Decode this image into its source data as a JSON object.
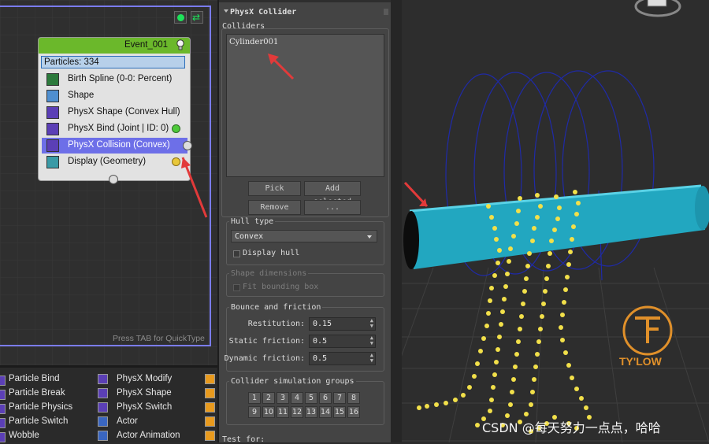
{
  "graph": {
    "quicktype_hint": "Press TAB for QuickType",
    "event": {
      "title": "Event_001",
      "particles": "Particles: 334",
      "operators": [
        {
          "label": "Birth Spline (0-0: Percent)",
          "icon": "birth-spline-icon",
          "selected": false
        },
        {
          "label": "Shape",
          "icon": "shape-icon",
          "selected": false
        },
        {
          "label": "PhysX Shape (Convex Hull)",
          "icon": "physx-shape-icon",
          "selected": false
        },
        {
          "label": "PhysX Bind (Joint | ID: 0)",
          "icon": "physx-bind-icon",
          "selected": false
        },
        {
          "label": "PhysX Collision (Convex)",
          "icon": "physx-collision-icon",
          "selected": true
        },
        {
          "label": "Display (Geometry)",
          "icon": "display-icon",
          "selected": false
        }
      ]
    }
  },
  "depot": {
    "col1": [
      "Particle Bind",
      "Particle Break",
      "Particle Physics",
      "Particle Switch",
      "Wobble"
    ],
    "col2": [
      "PhysX Modify",
      "PhysX Shape",
      "PhysX Switch",
      "Actor",
      "Actor Animation"
    ]
  },
  "panel": {
    "rollout_title": "PhysX Collider",
    "colliders_label": "Colliders",
    "collider_items": [
      "Cylinder001"
    ],
    "pick_label": "Pick",
    "add_selected_label": "Add selected",
    "remove_label": "Remove",
    "more_label": "...",
    "hull_type_title": "Hull type",
    "hull_type_value": "Convex",
    "display_hull_label": "Display hull",
    "shape_dimensions_title": "Shape dimensions",
    "fit_bounding_box_label": "Fit bounding box",
    "bounce_title": "Bounce and friction",
    "restitution_label": "Restitution:",
    "restitution_value": "0.15",
    "static_friction_label": "Static friction:",
    "static_friction_value": "0.5",
    "dynamic_friction_label": "Dynamic friction:",
    "dynamic_friction_value": "0.5",
    "groups_title": "Collider simulation groups",
    "groups": [
      "1",
      "2",
      "3",
      "4",
      "5",
      "6",
      "7",
      "8",
      "9",
      "10",
      "11",
      "12",
      "13",
      "14",
      "15",
      "16"
    ],
    "test_for_label": "Test for:"
  },
  "viewport": {
    "logo_text": "TY'LOW",
    "watermark": "CSDN @每天努力一点点，哈哈"
  },
  "colors": {
    "event_header": "#6bb82b",
    "selection": "#6d6fe8",
    "graph_border": "#7a7cf2",
    "cylinder": "#22a7c0",
    "particles": "#f2e04a",
    "spline": "#1f2aa8",
    "logo": "#e0902a",
    "annotation_arrow": "#e23a3a"
  }
}
